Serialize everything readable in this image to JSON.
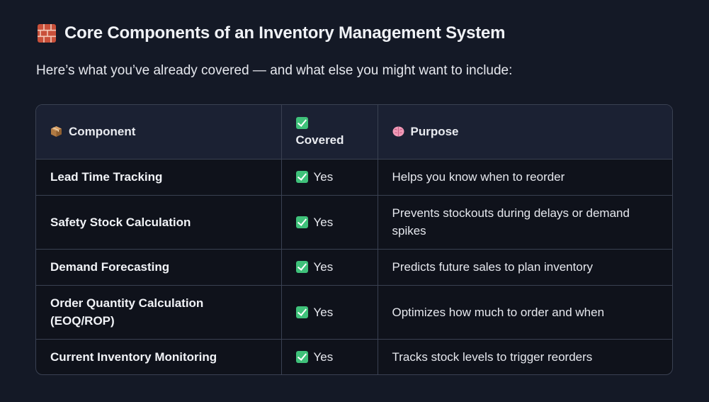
{
  "heading": {
    "icon": "brick-icon",
    "title": "Core Components of an Inventory Management System"
  },
  "intro": "Here’s what you’ve already covered — and what else you might want to include:",
  "table": {
    "headers": [
      {
        "icon": "package-icon",
        "label": "Component"
      },
      {
        "icon": "check-icon",
        "label": "Covered"
      },
      {
        "icon": "brain-icon",
        "label": "Purpose"
      }
    ],
    "rows": [
      {
        "component": "Lead Time Tracking",
        "covered": "Yes",
        "purpose": "Helps you know when to reorder"
      },
      {
        "component": "Safety Stock Calculation",
        "covered": "Yes",
        "purpose": "Prevents stockouts during delays or demand spikes"
      },
      {
        "component": "Demand Forecasting",
        "covered": "Yes",
        "purpose": "Predicts future sales to plan inventory"
      },
      {
        "component": "Order Quantity Calculation (EOQ/ROP)",
        "covered": "Yes",
        "purpose": "Optimizes how much to order and when"
      },
      {
        "component": "Current Inventory Monitoring",
        "covered": "Yes",
        "purpose": "Tracks stock levels to trigger reorders"
      }
    ]
  },
  "colors": {
    "background": "#141926",
    "header_row": "#1b2133",
    "table_body": "#0f121b",
    "border": "#3a4152",
    "check_green": "#3fc17a"
  }
}
